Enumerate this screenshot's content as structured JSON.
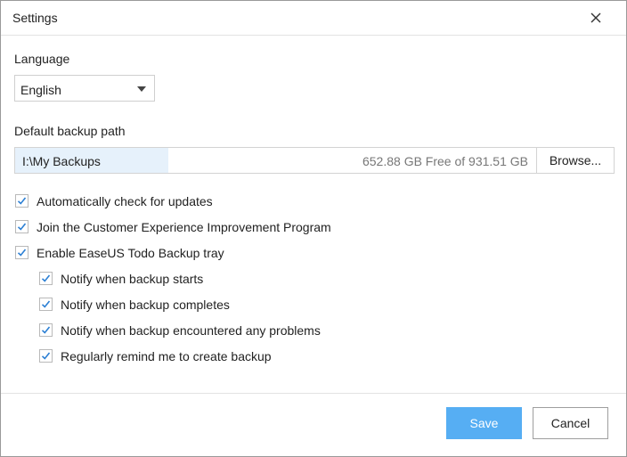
{
  "window": {
    "title": "Settings"
  },
  "language": {
    "label": "Language",
    "selected": "English"
  },
  "backup_path": {
    "label": "Default backup path",
    "path": "I:\\My Backups",
    "free_space": "652.88 GB Free of 931.51 GB",
    "browse_label": "Browse..."
  },
  "options": [
    {
      "label": "Automatically check for updates",
      "checked": true
    },
    {
      "label": "Join the Customer Experience Improvement Program",
      "checked": true
    },
    {
      "label": "Enable EaseUS Todo Backup tray",
      "checked": true
    }
  ],
  "tray_options": [
    {
      "label": "Notify when backup starts",
      "checked": true
    },
    {
      "label": "Notify when backup completes",
      "checked": true
    },
    {
      "label": "Notify when backup encountered any problems",
      "checked": true
    },
    {
      "label": "Regularly remind me to create backup",
      "checked": true
    }
  ],
  "footer": {
    "save_label": "Save",
    "cancel_label": "Cancel"
  },
  "colors": {
    "accent": "#56aef3",
    "check": "#2b7fd4"
  }
}
